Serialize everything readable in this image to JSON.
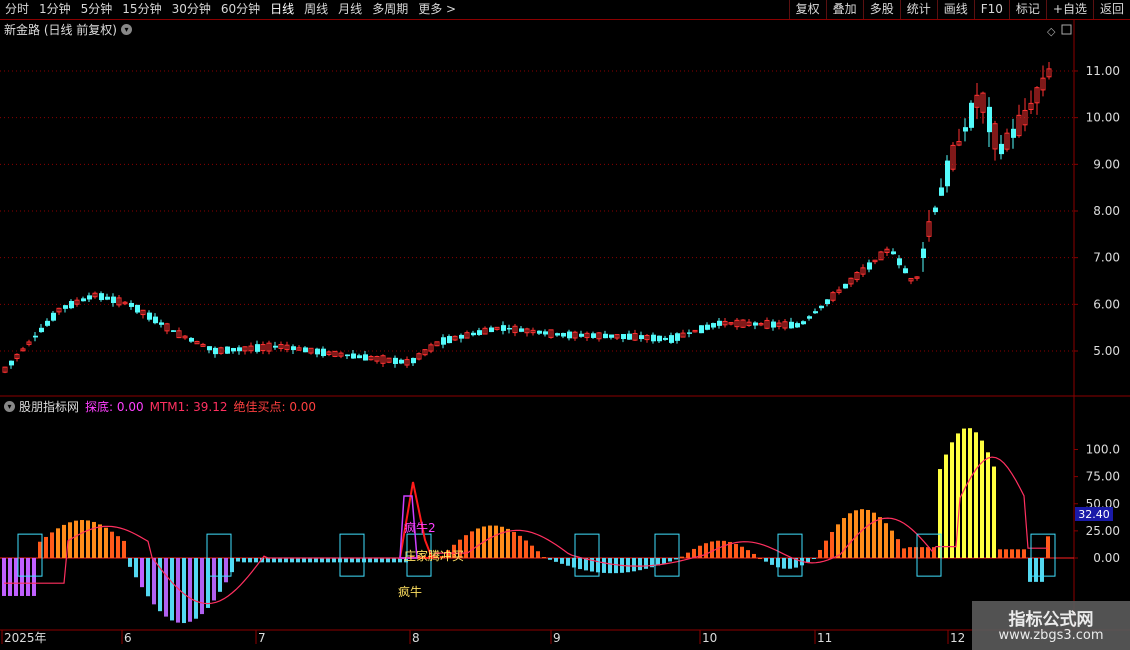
{
  "toolbar": {
    "left": [
      "分时",
      "1分钟",
      "5分钟",
      "15分钟",
      "30分钟",
      "60分钟",
      "日线",
      "周线",
      "月线",
      "多周期",
      "更多 >"
    ],
    "active_index": 6,
    "right": [
      "复权",
      "叠加",
      "多股",
      "统计",
      "画线",
      "F10",
      "标记",
      "+自选",
      "返回"
    ]
  },
  "main_title": "新金路 (日线 前复权)",
  "price_axis": [
    "11.00",
    "10.00",
    "9.00",
    "8.00",
    "7.00",
    "6.00",
    "5.00"
  ],
  "indicator": {
    "name": "股朋指标网",
    "items": [
      {
        "label": "探底: 0.00",
        "color": "#ff40ff"
      },
      {
        "label": "MTM1: 39.12",
        "color": "#ff3060"
      },
      {
        "label": "绝佳买点: 0.00",
        "color": "#ff4040"
      }
    ],
    "axis": [
      "100.0",
      "75.00",
      "50.00",
      "25.00",
      "0.00"
    ],
    "current_value": "32.40",
    "annotations": [
      "疯牛2",
      "庄家腾冲买",
      "疯牛"
    ]
  },
  "time_axis": [
    "2025年",
    "6",
    "7",
    "8",
    "9",
    "10",
    "11",
    "12"
  ],
  "watermark": {
    "title": "指标公式网",
    "url": "www.zbgs3.com"
  },
  "colors": {
    "up": "#ff3232",
    "down": "#54fcfc",
    "grid": "#8b0000",
    "axis_text": "#dcdcdc"
  }
}
